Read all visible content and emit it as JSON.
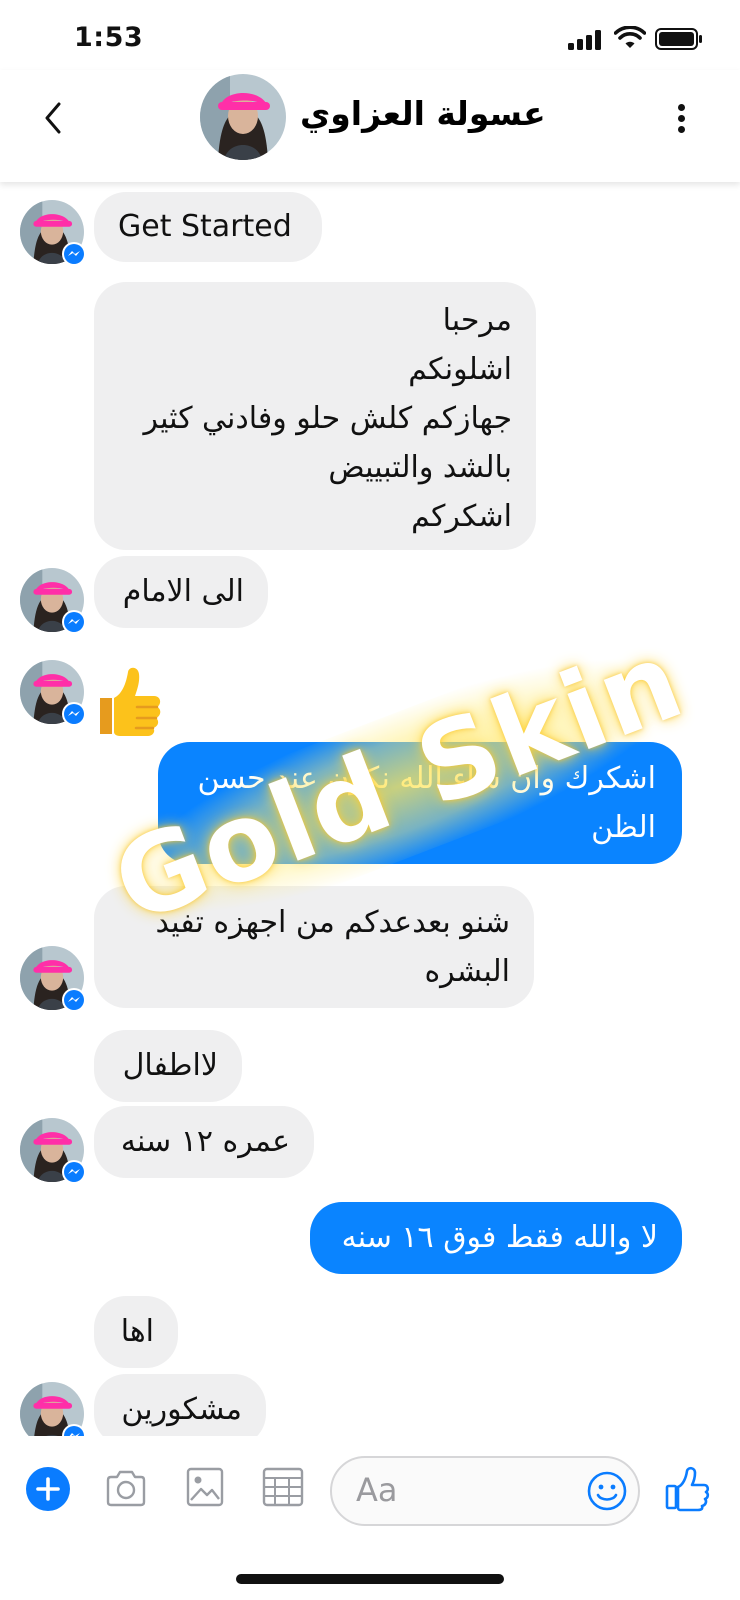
{
  "status_bar": {
    "time": "1:53"
  },
  "header": {
    "contact_name": "عسولة العزاوي"
  },
  "messages": [
    {
      "direction": "in",
      "text": "Get Started"
    },
    {
      "direction": "in",
      "lines": [
        "مرحبا",
        "اشلونكم",
        "جهازكم كلش حلو وفادني كثير",
        "بالشد والتبييض",
        "اشكركم"
      ]
    },
    {
      "direction": "in",
      "text": "الى الامام"
    },
    {
      "direction": "in",
      "emoji": "thumbs-up"
    },
    {
      "direction": "out",
      "lines": [
        "اشكرك وان شاء الله نكون عند حسن",
        "الظن"
      ]
    },
    {
      "direction": "in",
      "lines": [
        "شنو بعدعدكم من اجهزه تفيد",
        "البشره"
      ]
    },
    {
      "direction": "in",
      "text": "لااطفال"
    },
    {
      "direction": "in",
      "text": "عمره ١٢ سنه"
    },
    {
      "direction": "out",
      "text": "لا والله فقط فوق ١٦ سنه"
    },
    {
      "direction": "in",
      "text": "اها"
    },
    {
      "direction": "in",
      "text": "مشكورين"
    }
  ],
  "watermark": {
    "text": "Gold Skin"
  },
  "composer": {
    "placeholder": "Aa"
  },
  "colors": {
    "outgoing_bubble": "#0a84ff",
    "incoming_bubble": "#efeff0",
    "accent": "#0a7cff",
    "watermark_glow": "#ffe65a"
  },
  "icons": [
    "back-chevron",
    "more-vertical",
    "messenger-badge",
    "thumbs-up-emoji",
    "plus",
    "camera",
    "image",
    "sticker",
    "smiley",
    "like"
  ]
}
